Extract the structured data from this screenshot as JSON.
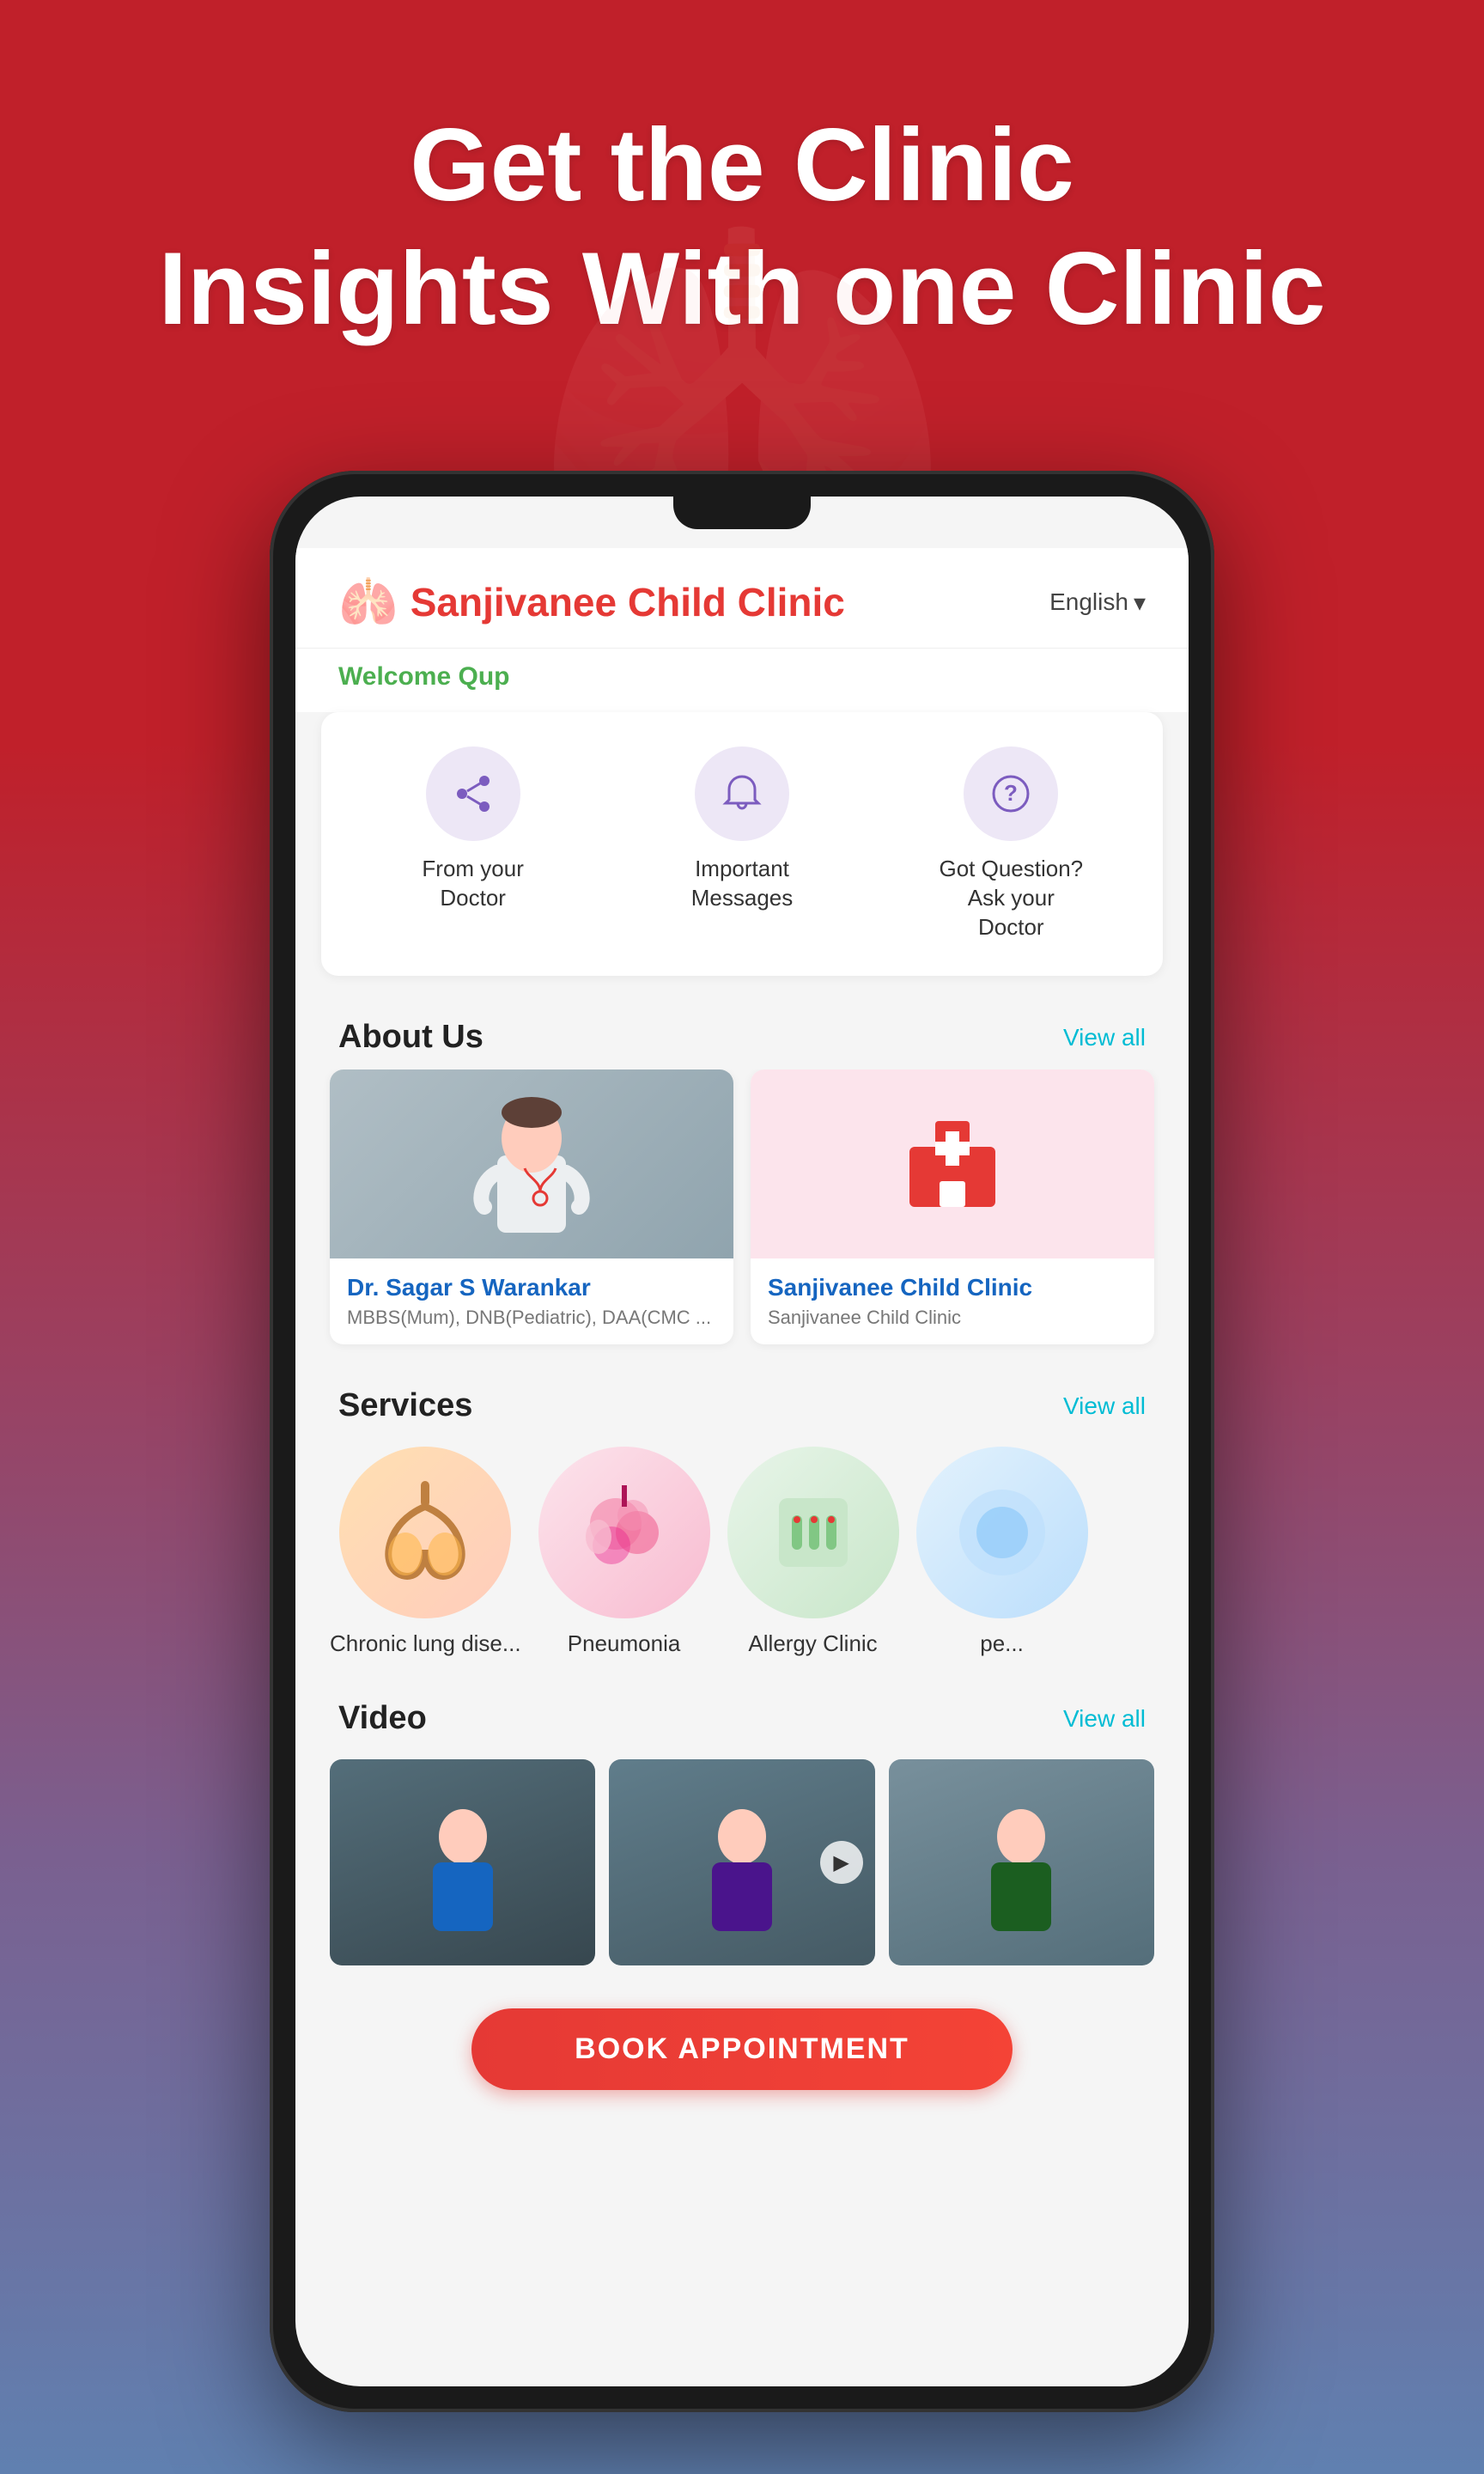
{
  "header": {
    "line1": "Get the Clinic",
    "line2": "Insights With one Clinic"
  },
  "app": {
    "clinic_name": "Sanjivanee Child Clinic",
    "clinic_icon": "🫁",
    "welcome_text": "Welcome Qup",
    "language": "English",
    "language_arrow": "▾",
    "actions": [
      {
        "icon": "↗",
        "label": "From your Doctor"
      },
      {
        "icon": "🔔",
        "label": "Important Messages"
      },
      {
        "icon": "?",
        "label": "Got Question? Ask your Doctor"
      }
    ],
    "about_section": {
      "title": "About Us",
      "view_all": "View all",
      "doctor": {
        "name": "Dr. Sagar S Warankar",
        "credentials": "MBBS(Mum), DNB(Pediatric), DAA(CMC ..."
      },
      "clinic": {
        "name": "Sanjivanee Child Clinic",
        "sub": "Sanjivanee Child Clinic"
      }
    },
    "services_section": {
      "title": "Services",
      "view_all": "View all",
      "items": [
        {
          "label": "Chronic lung dise...",
          "bg": "lung"
        },
        {
          "label": "Pneumonia",
          "bg": "pneumonia"
        },
        {
          "label": "Allergy Clinic",
          "bg": "allergy"
        },
        {
          "label": "pe...",
          "bg": "pe"
        }
      ]
    },
    "video_section": {
      "title": "Video",
      "view_all": "View all",
      "thumbs": [
        {
          "id": 1
        },
        {
          "id": 2
        },
        {
          "id": 3
        }
      ]
    },
    "book_btn": "BOOK APPOINTMENT"
  }
}
